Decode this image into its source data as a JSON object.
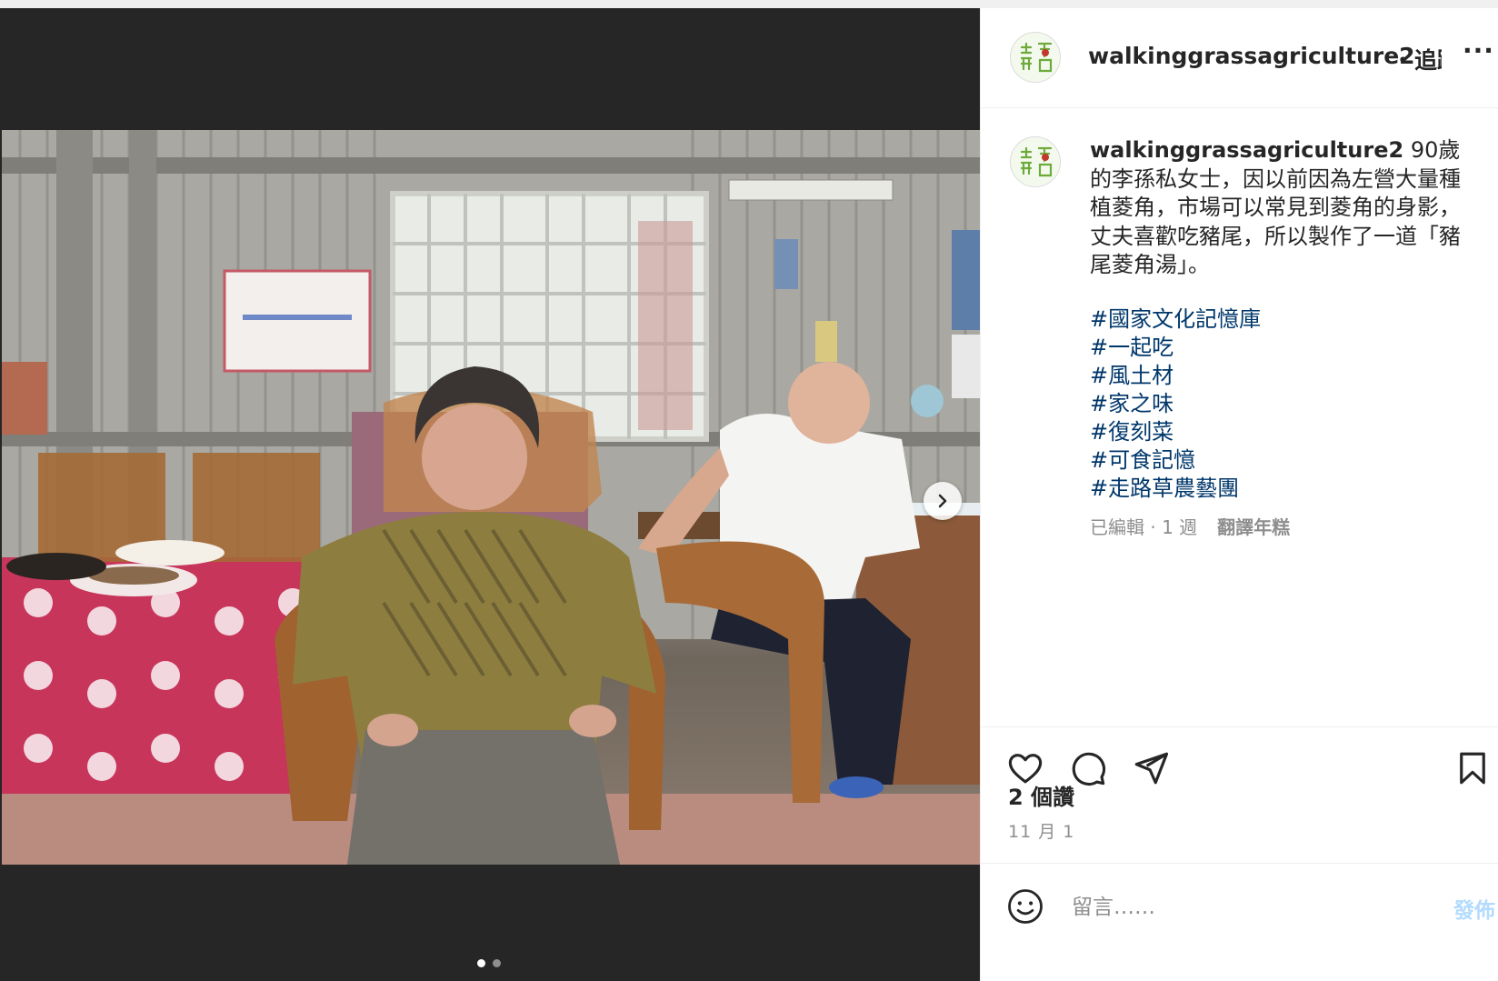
{
  "post": {
    "username": "walkinggrassagriculture2",
    "follow_label": "・追蹤",
    "more_label": "···",
    "caption_username": "walkinggrassagriculture2",
    "caption_text": " 90歲的李孫私女士，因以前因為左營大量種植菱角，市場可以常見到菱角的身影，丈夫喜歡吃豬尾，所以製作了一道「豬尾菱角湯」。",
    "hashtags": [
      "#國家文化記憶庫",
      "#一起吃",
      "#風土材",
      "#家之味",
      "#復刻菜",
      "#可食記憶",
      "#走路草農藝團"
    ],
    "meta_text": "已編輯 · 1 週",
    "translate_label": "翻譯年糕",
    "likes_text": "2 個讚",
    "date_text": "11 月 1"
  },
  "carousel": {
    "total": 2,
    "current": 1
  },
  "comment": {
    "placeholder": "留言……",
    "post_label": "發佈"
  },
  "icons": {
    "like": "heart-icon",
    "comment": "comment-bubble-icon",
    "share": "paper-plane-icon",
    "save": "bookmark-icon",
    "emoji": "emoji-icon",
    "next": "chevron-right-icon"
  }
}
